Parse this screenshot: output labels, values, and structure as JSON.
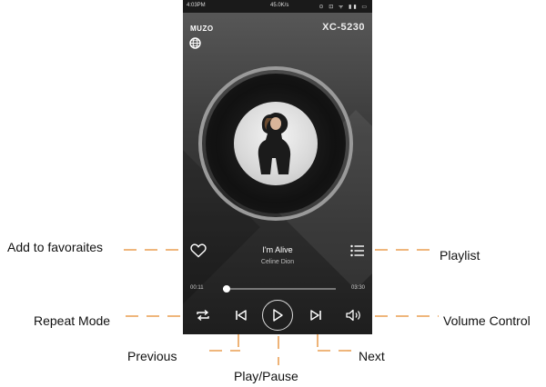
{
  "status_bar": {
    "time": "4:03PM",
    "speed": "45.0K/s",
    "icons": "⊙ ⊡ ᯤ ▮▮ ▭"
  },
  "header": {
    "brand": "MUZO",
    "brand_icon": "globe-icon",
    "model": "XC-5230"
  },
  "now_playing": {
    "title": "I'm Alive",
    "artist": "Celine Dion"
  },
  "progress": {
    "elapsed": "00:11",
    "total": "03:30",
    "fraction": 0.03
  },
  "controls": {
    "favorite": "heart-icon",
    "playlist": "list-icon",
    "repeat": "repeat-icon",
    "previous": "skip-previous-icon",
    "play_pause": "play-icon",
    "next": "skip-next-icon",
    "volume": "volume-icon"
  },
  "callouts": {
    "favorites": "Add to favoraites",
    "playlist": "Playlist",
    "repeat": "Repeat Mode",
    "volume": "Volume Control",
    "previous": "Previous",
    "next": "Next",
    "play_pause": "Play/Pause"
  },
  "colors": {
    "accent_leader": "#e58a2e",
    "screen_bg": "#2b2b2b"
  }
}
